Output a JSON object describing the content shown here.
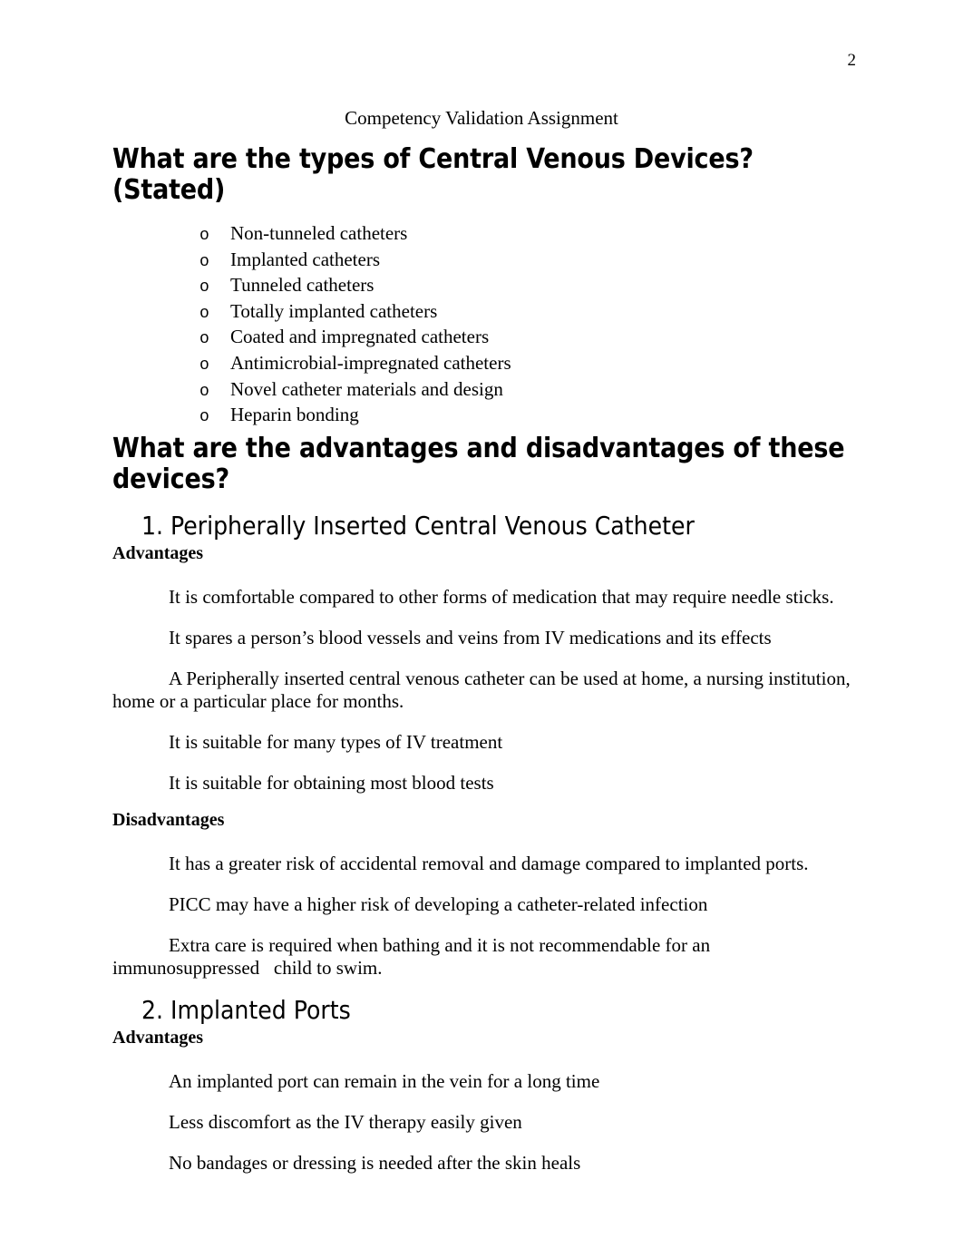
{
  "page": {
    "number": "2",
    "subtitle": "Competency Validation Assignment"
  },
  "headings": {
    "types_question": "What are the types of Central Venous Devices? (Stated)",
    "advantages_question": "What are the advantages and disadvantages of these devices?"
  },
  "device_types": {
    "bullet_marker": "o",
    "items": [
      "Non-tunneled catheters",
      "Implanted catheters",
      "Tunneled catheters",
      "Totally implanted catheters",
      "Coated and impregnated catheters",
      "Antimicrobial-impregnated catheters",
      "Novel catheter materials and design",
      "Heparin bonding"
    ]
  },
  "sections": [
    {
      "heading": "1. Peripherally Inserted Central Venous Catheter",
      "advantages_label": "Advantages",
      "advantages": [
        "It is comfortable compared to other forms of medication that may require needle sticks.",
        "It spares a person’s blood vessels and veins from IV medications and its effects",
        "A Peripherally inserted central venous catheter can be used at home, a nursing institution, home or a particular place for months.",
        "It is suitable for many types of IV treatment",
        "It is suitable for obtaining most blood tests"
      ],
      "disadvantages_label": "Disadvantages",
      "disadvantages": [
        "It has a greater risk of accidental removal and damage compared to implanted ports.",
        "PICC may have a higher risk of developing a catheter-related infection",
        "Extra care is required when bathing and it is not recommendable for an immunosuppressed   child to swim."
      ]
    },
    {
      "heading": "2. Implanted Ports",
      "advantages_label": "Advantages",
      "advantages": [
        "An implanted port can remain in the vein for a long time",
        "Less discomfort as the IV therapy easily given",
        "No bandages or dressing is needed after the skin heals"
      ]
    }
  ]
}
